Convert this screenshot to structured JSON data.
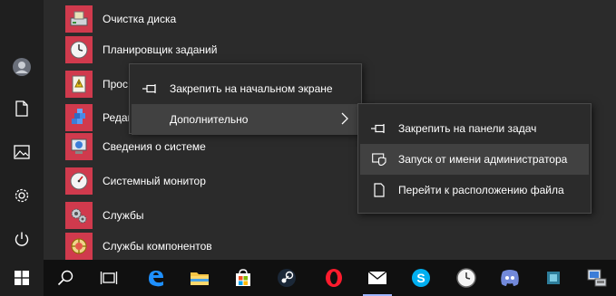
{
  "apps": [
    {
      "label": "Очистка диска",
      "icon": "disk-cleanup-icon"
    },
    {
      "label": "Планировщик заданий",
      "icon": "task-scheduler-icon"
    },
    {
      "label": "Прос",
      "icon": "event-viewer-icon"
    },
    {
      "label": "Редак",
      "icon": "registry-editor-icon"
    },
    {
      "label": "Сведения о системе",
      "icon": "system-info-icon"
    },
    {
      "label": "Системный монитор",
      "icon": "performance-monitor-icon"
    },
    {
      "label": "Службы",
      "icon": "services-icon"
    },
    {
      "label": "Службы компонентов",
      "icon": "component-services-icon"
    }
  ],
  "context_menu": {
    "pin_start": "Закрепить на начальном экране",
    "more": "Дополнительно"
  },
  "submenu": {
    "pin_taskbar": "Закрепить на панели задач",
    "run_as_admin": "Запуск от имени администратора",
    "open_location": "Перейти к расположению файла"
  },
  "rail": [
    "avatar",
    "documents-icon",
    "pictures-icon",
    "settings-gear-icon",
    "power-icon"
  ],
  "taskbar": [
    "windows-start-icon",
    "search-icon",
    "task-view-icon",
    "edge-icon",
    "file-explorer-icon",
    "store-icon",
    "steam-icon",
    "opera-icon",
    "mail-icon",
    "skype-icon",
    "clock-icon",
    "discord-icon",
    "network-icon"
  ],
  "colors": {
    "tile": "#d03a4d",
    "menu_bg": "#2b2b2b",
    "highlight": "#414141",
    "taskbar": "#101010"
  }
}
